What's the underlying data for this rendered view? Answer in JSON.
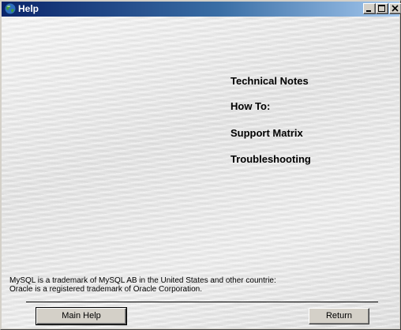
{
  "window": {
    "title": "Help",
    "icons": {
      "app": "globe-icon",
      "minimize": "minimize-icon",
      "maximize": "maximize-icon",
      "close": "close-icon"
    }
  },
  "links": [
    {
      "label": "Technical Notes"
    },
    {
      "label": "How To:"
    },
    {
      "label": "Support Matrix"
    },
    {
      "label": "Troubleshooting"
    }
  ],
  "footer": {
    "trademark_lines": [
      "MySQL is a trademark of MySQL AB in the United States and other countrie:",
      "Oracle is a registered trademark of Oracle Corporation."
    ]
  },
  "buttons": {
    "main_help": "Main Help",
    "return": "Return"
  }
}
